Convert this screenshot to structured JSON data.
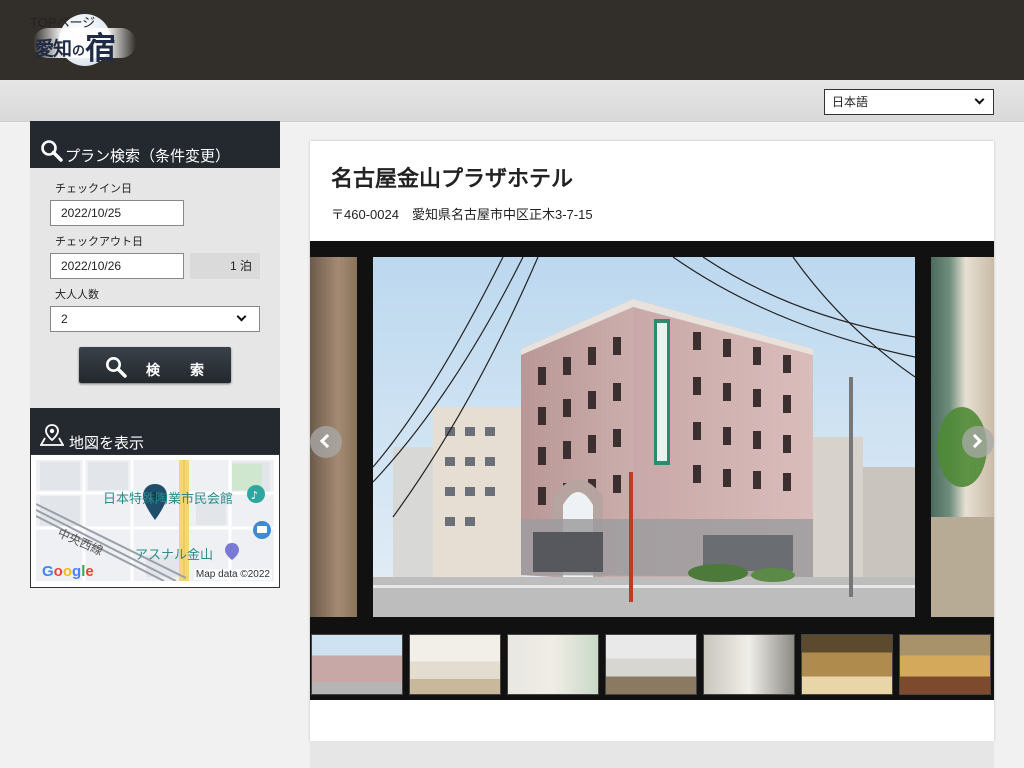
{
  "site": {
    "logo_alt": "愛知の宿",
    "logo_part1": "愛知",
    "logo_part2": "の",
    "logo_part3": "宿"
  },
  "nav": {
    "top_link": "TOPページ",
    "language_selected": "日本語"
  },
  "search_panel": {
    "title": "プラン検索（条件変更）",
    "checkin_label": "チェックイン日",
    "checkin_value": "2022/10/25",
    "checkout_label": "チェックアウト日",
    "checkout_value": "2022/10/26",
    "nights": "1 泊",
    "adults_label": "大人人数",
    "adults_value": "2",
    "search_button": "検　索"
  },
  "map_panel": {
    "title": "地図を表示",
    "labels": {
      "hall": "日本特殊陶業市民会館",
      "line": "中央西線",
      "mall": "アスナル金山"
    },
    "attribution": "Map data ©2022",
    "provider": "Google"
  },
  "hotel": {
    "name": "名古屋金山プラザホテル",
    "postal": "〒460-0024",
    "address": "愛知県名古屋市中区正木3-7-15"
  },
  "gallery": {
    "thumbnail_count": 7,
    "icons": {
      "prev": "chevron-left-icon",
      "next": "chevron-right-icon",
      "search": "search-icon",
      "map": "map-pin-icon"
    }
  }
}
